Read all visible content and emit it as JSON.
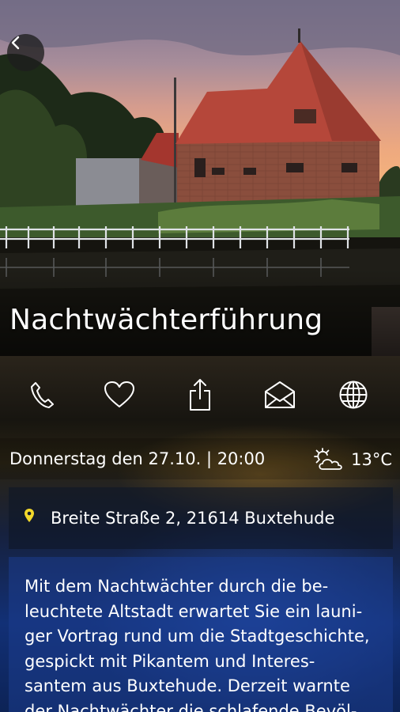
{
  "event": {
    "title": "Nachtwächterführung",
    "date_time": "Donnerstag den 27.10. | 20:00",
    "address": "Breite Straße 2, 21614 Buxtehude",
    "description": "Mit dem Nachtwächter durch die be-\nleuchtete Altstadt erwartet Sie ein launi-\nger Vortrag rund um die Stadtgeschichte,\ngespickt mit Pikantem und Interes-\nsantem aus Buxtehude. Derzeit warnte\nder Nachtwächter die schlafende Bevöl-"
  },
  "weather": {
    "temperature": "13°C",
    "icon": "partly-cloudy-icon"
  },
  "toolbar": {
    "icons": [
      "back-icon",
      "phone-icon",
      "heart-icon",
      "share-icon",
      "mail-icon",
      "globe-icon"
    ]
  },
  "colors": {
    "pin": "#f2d82b",
    "text": "#ffffff"
  }
}
